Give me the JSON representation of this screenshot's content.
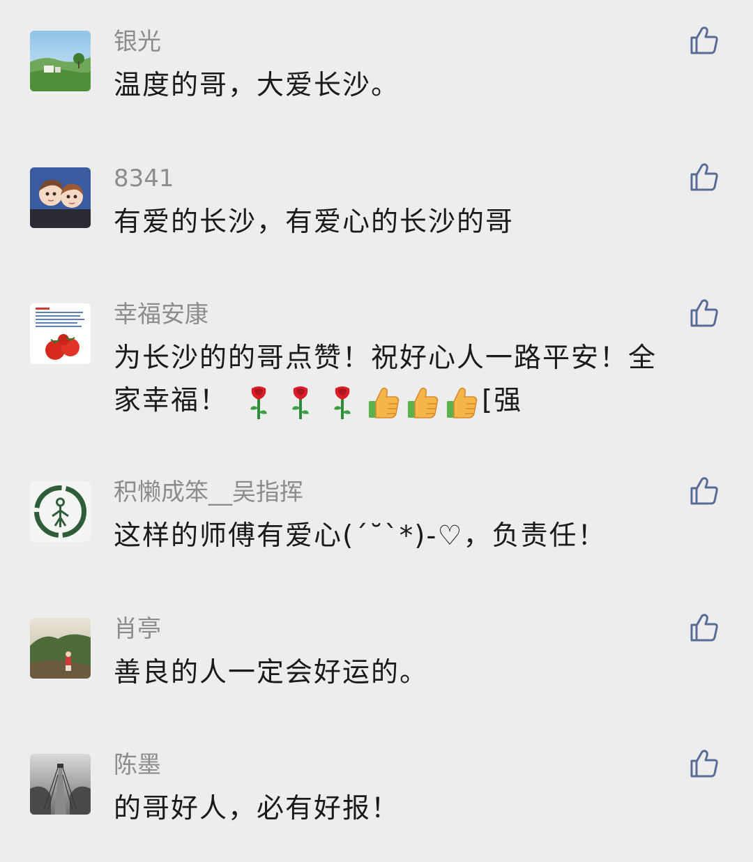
{
  "comments": [
    {
      "username": "银光",
      "text": "温度的哥，大爱长沙。"
    },
    {
      "username": "8341",
      "text": "有爱的长沙，有爱心的长沙的哥"
    },
    {
      "username": "幸福安康",
      "text_line1": "为长沙的的哥点赞！祝好心人一路平安！全",
      "text_line2_start": "家幸福！",
      "text_line2_end": "[强"
    },
    {
      "username": "积懒成笨__吴指挥",
      "text": "这样的师傅有爱心(ˊ˘ˋ*)-♡，负责任！"
    },
    {
      "username": "肖亭",
      "text": "善良的人一定会好运的。"
    },
    {
      "username": "陈墨",
      "text": "的哥好人，必有好报！"
    }
  ],
  "icons": {
    "like": "thumbs-up-outline-icon",
    "rose": "rose-emoji",
    "thumb": "thumbs-up-emoji"
  },
  "colors": {
    "background": "#ededed",
    "username": "#8c8c8c",
    "content": "#1a1a1a",
    "like_icon": "#576b95"
  }
}
